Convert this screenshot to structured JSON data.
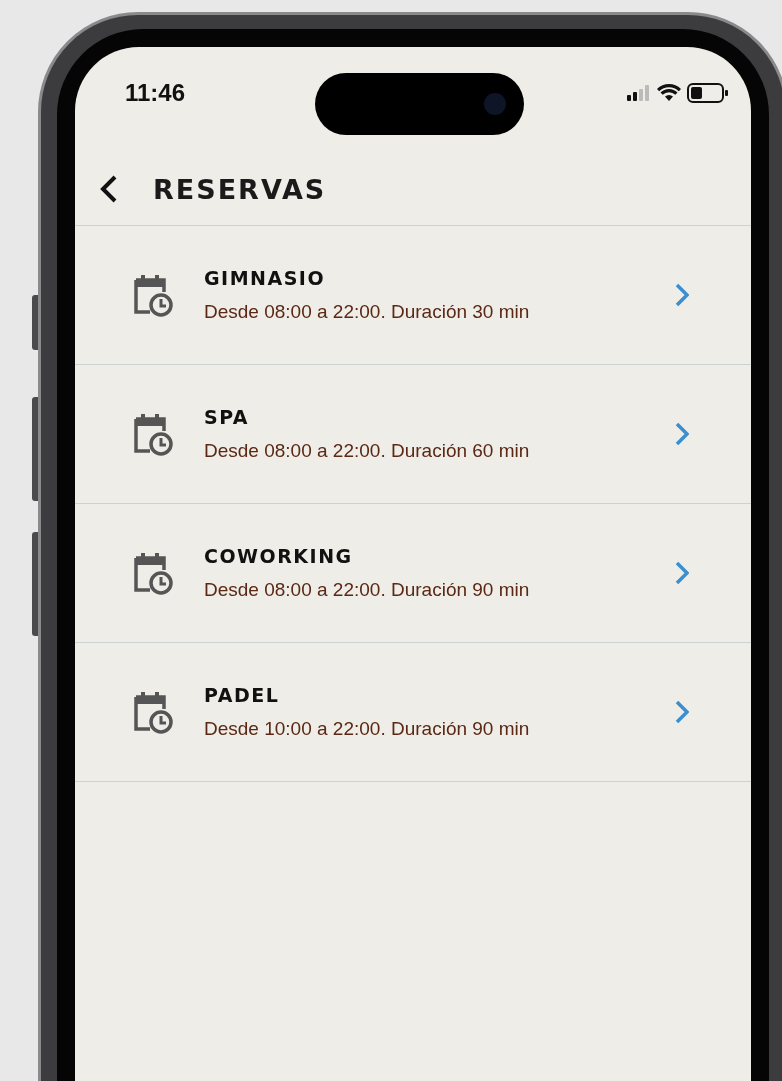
{
  "status_bar": {
    "time": "11:46"
  },
  "header": {
    "title": "RESERVAS"
  },
  "items": [
    {
      "title": "GIMNASIO",
      "subtitle": "Desde 08:00 a 22:00. Duración 30 min"
    },
    {
      "title": "SPA",
      "subtitle": "Desde 08:00 a 22:00. Duración 60 min"
    },
    {
      "title": "COWORKING",
      "subtitle": "Desde 08:00 a 22:00. Duración 90 min"
    },
    {
      "title": "PADEL",
      "subtitle": "Desde 10:00 a 22:00. Duración 90 min"
    }
  ]
}
